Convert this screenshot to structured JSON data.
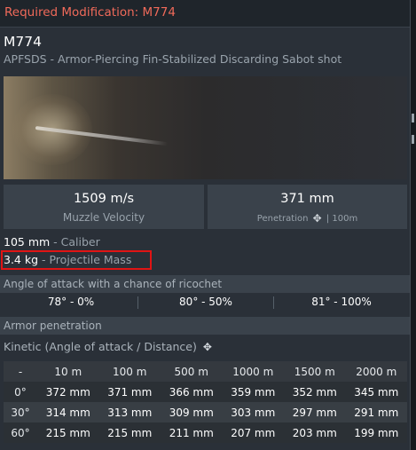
{
  "header": {
    "required_modification": "Required Modification: M774"
  },
  "shell": {
    "name": "M774",
    "type": "APFSDS - Armor-Piercing Fin-Stabilized Discarding Sabot shot"
  },
  "stats": {
    "muzzle_velocity": {
      "value": "1509 m/s",
      "label": "Muzzle Velocity"
    },
    "penetration": {
      "value": "371 mm",
      "label": "Penetration",
      "distance": "| 100m"
    }
  },
  "properties": {
    "caliber": {
      "value": "105 mm",
      "label": " - Caliber"
    },
    "mass": {
      "value": "3.4 kg",
      "label": " - Projectile Mass"
    }
  },
  "ricochet": {
    "title": "Angle of attack with a chance of ricochet",
    "values": [
      "78° - 0%",
      "80° - 50%",
      "81° - 100%"
    ]
  },
  "armor": {
    "title": "Armor penetration",
    "kinetic_label": "Kinetic (Angle of attack / Distance)",
    "columns": [
      "-",
      "10 m",
      "100 m",
      "500 m",
      "1000 m",
      "1500 m",
      "2000 m"
    ],
    "rows": [
      {
        "angle": "0°",
        "values": [
          "372 mm",
          "371 mm",
          "366 mm",
          "359 mm",
          "352 mm",
          "345 mm"
        ]
      },
      {
        "angle": "30°",
        "values": [
          "314 mm",
          "313 mm",
          "309 mm",
          "303 mm",
          "297 mm",
          "291 mm"
        ]
      },
      {
        "angle": "60°",
        "values": [
          "215 mm",
          "215 mm",
          "211 mm",
          "207 mm",
          "203 mm",
          "199 mm"
        ]
      }
    ]
  },
  "icons": {
    "penetration": "crosshair-arrow-icon",
    "kinetic": "crosshair-arrow-icon"
  },
  "colors": {
    "header_text": "#f06a5a",
    "highlight_box": "#e01414"
  }
}
